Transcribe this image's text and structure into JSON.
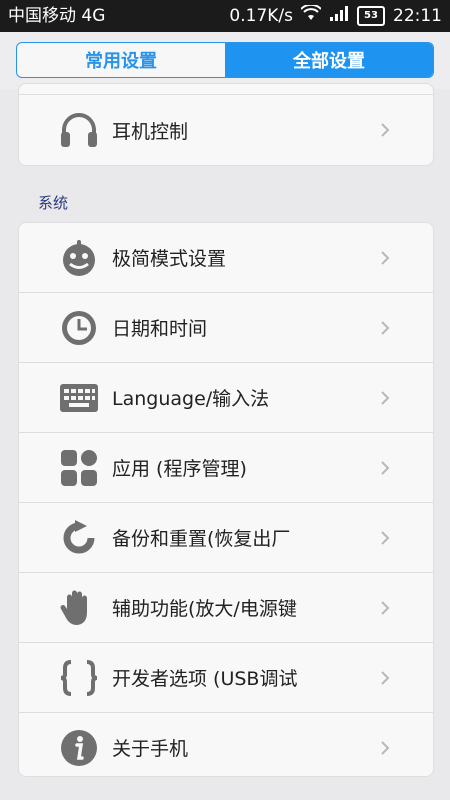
{
  "status_bar": {
    "carrier": "中国移动 4G",
    "speed": "0.17K/s",
    "battery": "53",
    "time": "22:11"
  },
  "tabs": [
    {
      "label": "常用设置",
      "active": false
    },
    {
      "label": "全部设置",
      "active": true
    }
  ],
  "top_card": {
    "items": [
      {
        "label": "耳机控制",
        "icon": "headphones-icon"
      }
    ]
  },
  "system": {
    "title": "系统",
    "items": [
      {
        "label": "极简模式设置",
        "icon": "smile-face-icon"
      },
      {
        "label": "日期和时间",
        "icon": "clock-icon"
      },
      {
        "label": "Language/输入法",
        "icon": "keyboard-icon"
      },
      {
        "label": "应用 (程序管理)",
        "icon": "apps-grid-icon"
      },
      {
        "label": "备份和重置(恢复出厂",
        "icon": "backup-restore-icon"
      },
      {
        "label": "辅助功能(放大/电源键",
        "icon": "hand-icon"
      },
      {
        "label": "开发者选项 (USB调试",
        "icon": "braces-icon"
      },
      {
        "label": "关于手机",
        "icon": "info-icon"
      }
    ]
  },
  "colors": {
    "accent": "#1e94f0",
    "section_title": "#2a3a7a",
    "icon_gray": "#6f6f6f"
  }
}
